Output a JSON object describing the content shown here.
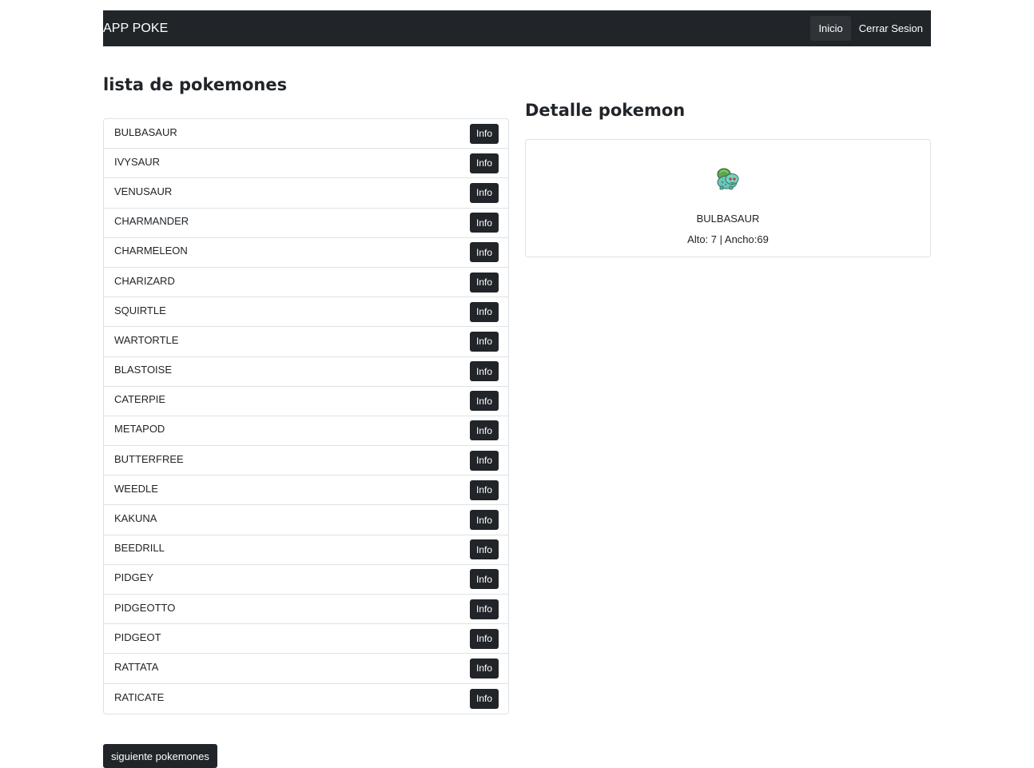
{
  "navbar": {
    "brand": "APP POKE",
    "links": [
      {
        "label": "Inicio",
        "active": true
      },
      {
        "label": "Cerrar Sesion",
        "active": false
      }
    ]
  },
  "list": {
    "title": "lista de pokemones",
    "info_label": "Info",
    "items": [
      "BULBASAUR",
      "IVYSAUR",
      "VENUSAUR",
      "CHARMANDER",
      "CHARMELEON",
      "CHARIZARD",
      "SQUIRTLE",
      "WARTORTLE",
      "BLASTOISE",
      "CATERPIE",
      "METAPOD",
      "BUTTERFREE",
      "WEEDLE",
      "KAKUNA",
      "BEEDRILL",
      "PIDGEY",
      "PIDGEOTTO",
      "PIDGEOT",
      "RATTATA",
      "RATICATE"
    ],
    "next_label": "siguiente pokemones"
  },
  "detail": {
    "title": "Detalle pokemon",
    "name": "BULBASAUR",
    "meta": "Alto: 7 | Ancho:69",
    "sprite_icon": "bulbasaur-sprite-icon"
  },
  "colors": {
    "dark": "#212529",
    "border": "#dee2e6",
    "bulbasaur_body": "#6cc6b4",
    "bulbasaur_bulb": "#5aa84a"
  }
}
